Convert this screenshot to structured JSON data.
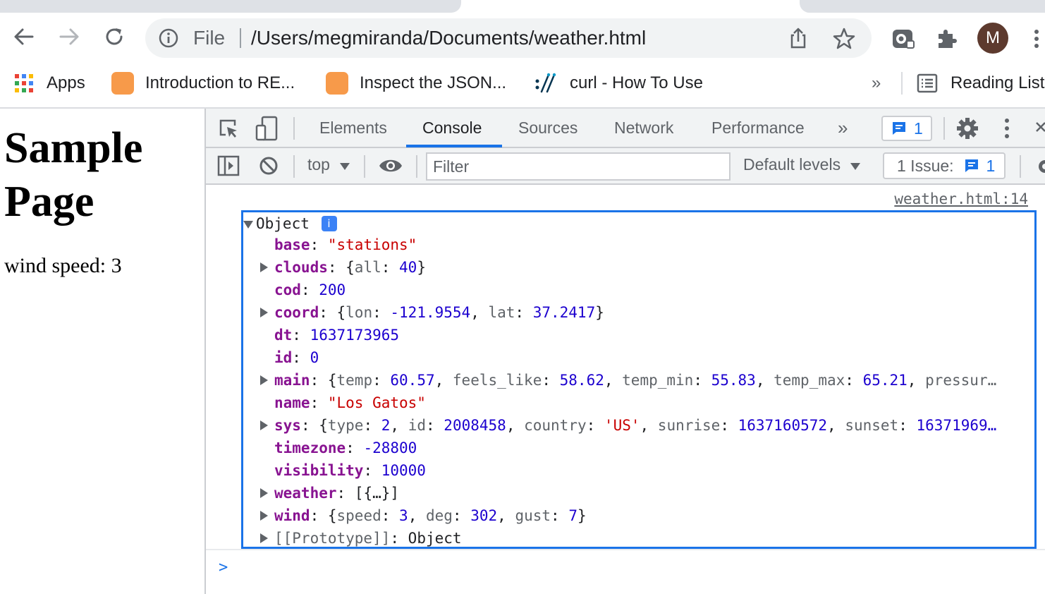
{
  "browser": {
    "omnibox": {
      "scheme_label": "File",
      "url": "/Users/megmiranda/Documents/weather.html"
    },
    "profile_initial": "M",
    "bookmarks": [
      {
        "label": "Apps",
        "icon": "apps-grid-icon"
      },
      {
        "label": "Introduction to RE...",
        "icon": "orange-favicon"
      },
      {
        "label": "Inspect the JSON...",
        "icon": "orange-favicon"
      },
      {
        "label": "curl - How To Use",
        "icon": "curl-favicon"
      }
    ],
    "overflow_label": "»",
    "reading_list_label": "Reading List"
  },
  "page": {
    "heading": "Sample Page",
    "paragraph": "wind speed: 3"
  },
  "devtools": {
    "tabs": [
      "Elements",
      "Console",
      "Sources",
      "Network",
      "Performance"
    ],
    "active_tab": "Console",
    "more_tabs": "»",
    "message_count": "1",
    "context": "top",
    "filter_placeholder": "Filter",
    "levels_label": "Default levels",
    "issues_label": "1 Issue:",
    "issues_count": "1",
    "source_link": "weather.html:14",
    "object_label": "Object",
    "info_glyph": "i",
    "prompt": ">",
    "accent_color": "#1a73e8"
  },
  "object": {
    "base": "\"stations\"",
    "clouds_all": "40",
    "cod": "200",
    "coord_lon": "-121.9554",
    "coord_lat": "37.2417",
    "dt": "1637173965",
    "id": "0",
    "main_temp": "60.57",
    "main_feels_like": "58.62",
    "main_temp_min": "55.83",
    "main_temp_max": "65.21",
    "main_tail": "pressur…",
    "name": "\"Los Gatos\"",
    "sys_type": "2",
    "sys_id": "2008458",
    "sys_country": "'US'",
    "sys_sunrise": "1637160572",
    "sys_sunset": "16371969…",
    "timezone": "-28800",
    "visibility": "10000",
    "weather": "[{…}]",
    "wind_speed": "3",
    "wind_deg": "302",
    "wind_gust": "7",
    "prototype_key": "[[Prototype]]",
    "prototype_value": "Object"
  }
}
